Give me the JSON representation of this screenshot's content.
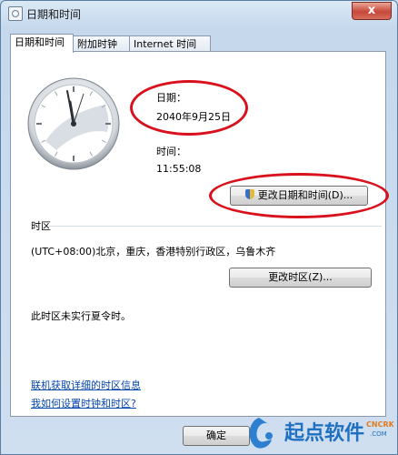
{
  "window": {
    "title": "日期和时间",
    "close_label": "x"
  },
  "tabs": [
    {
      "label": "日期和时间",
      "active": true
    },
    {
      "label": "附加时钟",
      "active": false
    },
    {
      "label": "Internet 时间",
      "active": false
    }
  ],
  "date": {
    "label": "日期：",
    "value": "2040年9月25日"
  },
  "time": {
    "label": "时间：",
    "value": "11:55:08"
  },
  "buttons": {
    "change_datetime": "更改日期和时间(D)...",
    "change_timezone": "更改时区(Z)...",
    "ok": "确定"
  },
  "timezone": {
    "heading": "时区",
    "value": "(UTC+08:00)北京，重庆，香港特别行政区，乌鲁木齐",
    "dst_note": "此时区未实行夏令时。"
  },
  "links": {
    "online_info": "联机获取详细的时区信息",
    "how_to_set": "我如何设置时钟和时区?"
  },
  "watermark": {
    "text": "起点软件",
    "sub": "CNCRK.COM"
  },
  "colors": {
    "highlight_ring": "#d8111c",
    "link": "#0645ad"
  }
}
